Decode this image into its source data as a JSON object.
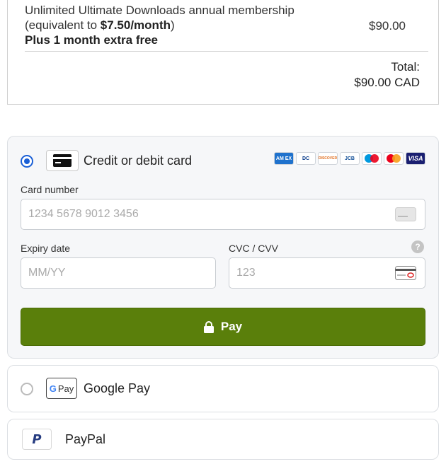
{
  "order": {
    "item_line1": "Unlimited Ultimate Downloads annual membership",
    "item_line2_prefix": "(equivalent to ",
    "item_line2_bold": "$7.50/month",
    "item_line2_suffix": ")",
    "item_extra": "Plus 1 month extra free",
    "item_price": "$90.00",
    "total_label": "Total:",
    "total_value": "$90.00 CAD"
  },
  "payment": {
    "card": {
      "label": "Credit or debit card",
      "selected": true,
      "brands": [
        "amex",
        "diners-club",
        "discover",
        "jcb",
        "maestro",
        "mastercard",
        "visa"
      ],
      "brand_text": {
        "amex": "AM EX",
        "diners": "DC",
        "discover": "DISCOVER",
        "jcb": "JCB",
        "visa": "VISA"
      },
      "card_number_label": "Card number",
      "card_number_placeholder": "1234 5678 9012 3456",
      "expiry_label": "Expiry date",
      "expiry_placeholder": "MM/YY",
      "cvc_label": "CVC / CVV",
      "cvc_placeholder": "123",
      "help_icon_text": "?",
      "pay_button_label": "Pay"
    },
    "google_pay": {
      "label": "Google Pay",
      "badge_g": "G",
      "badge_text": "Pay",
      "selected": false
    },
    "paypal": {
      "label": "PayPal",
      "logo_text": "P"
    }
  },
  "colors": {
    "accent_blue": "#1a5fd6",
    "pay_button": "#5a7f0b",
    "amex": "#1f72cd",
    "visa": "#1a1f71",
    "mastercard_red": "#eb001b",
    "mastercard_yellow": "#f79e1b",
    "maestro_blue": "#0099df",
    "paypal_dark": "#253b80",
    "paypal_light": "#179bd7"
  }
}
